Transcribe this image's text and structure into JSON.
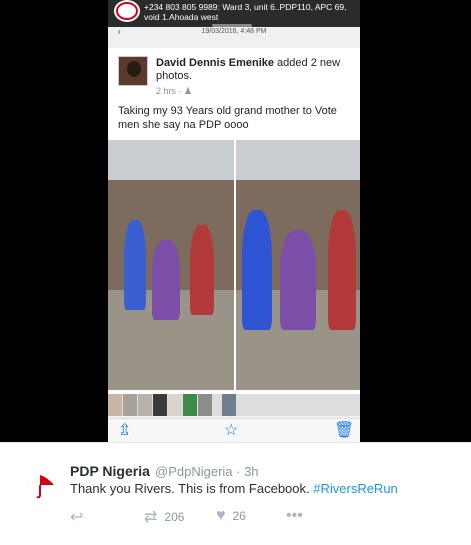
{
  "notification": {
    "line1": "+234 803 805 9989: Ward 3, unit 6..PDP110, APC 69,",
    "line2": "void 1.Ahoada west"
  },
  "post": {
    "date": "19/03/2016, 4:48 PM",
    "author": "David Dennis Emenike",
    "action": " added 2 new photos.",
    "time": "2 hrs",
    "caption": "Taking my 93 Years old grand mother to Vote men she say na PDP oooo"
  },
  "tweet": {
    "name": "PDP Nigeria",
    "handle": "@PdpNigeria · 3h",
    "text": "Thank you Rivers. This is from Facebook. ",
    "hashtag": "#RiversReRun",
    "retweet_count": "206",
    "like_count": "26",
    "more": "•••"
  },
  "icons": {
    "reply": "reply-icon",
    "retweet": "retweet-icon",
    "like": "heart-icon",
    "more": "more-icon",
    "share": "share-icon",
    "star": "star-icon",
    "trash": "trash-icon"
  },
  "colors": {
    "link": "#1b95e0",
    "pdp_red": "#d4001a",
    "pdp_green": "#008a3e"
  }
}
